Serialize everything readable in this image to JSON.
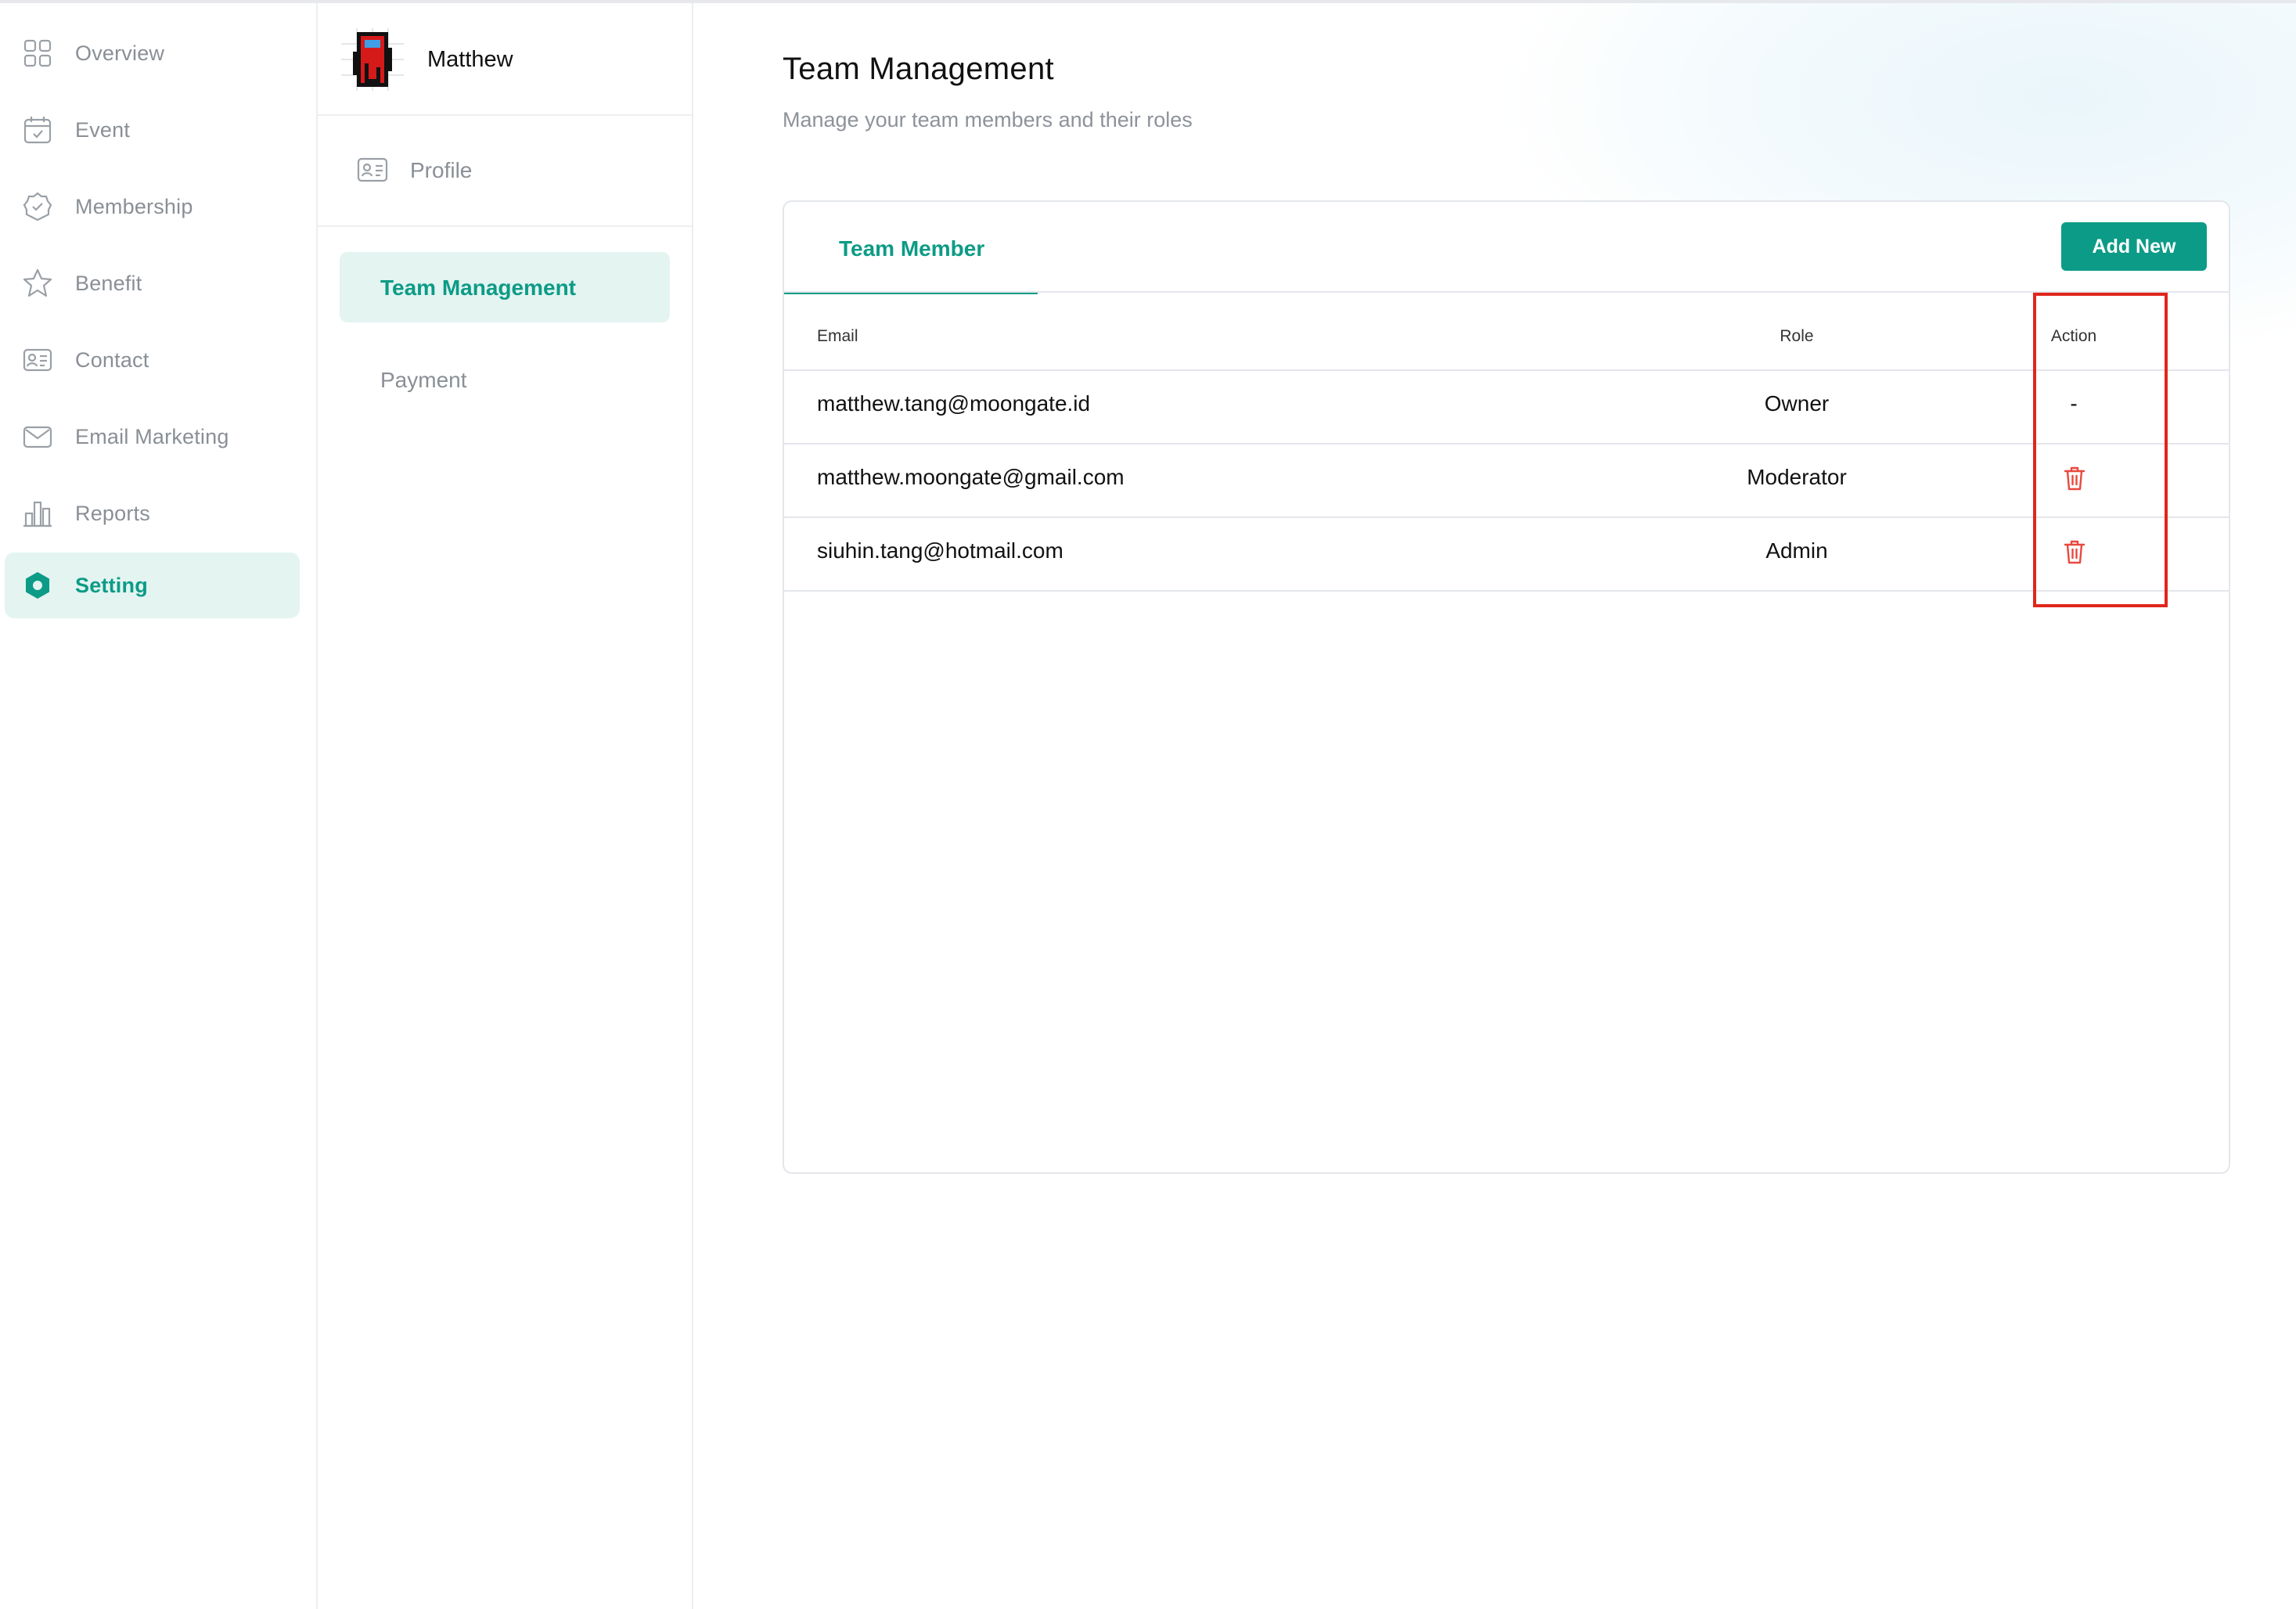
{
  "nav": {
    "items": [
      {
        "label": "Overview",
        "icon": "grid-icon"
      },
      {
        "label": "Event",
        "icon": "calendar-check-icon"
      },
      {
        "label": "Membership",
        "icon": "badge-check-icon"
      },
      {
        "label": "Benefit",
        "icon": "star-icon"
      },
      {
        "label": "Contact",
        "icon": "id-card-icon"
      },
      {
        "label": "Email Marketing",
        "icon": "mail-icon"
      },
      {
        "label": "Reports",
        "icon": "bar-chart-icon"
      },
      {
        "label": "Setting",
        "icon": "hexagon-icon",
        "active": true
      }
    ]
  },
  "settings": {
    "username": "Matthew",
    "profile_label": "Profile",
    "menu": [
      {
        "label": "Team Management",
        "active": true
      },
      {
        "label": "Payment"
      }
    ]
  },
  "main": {
    "title": "Team Management",
    "subtitle": "Manage your team members and their roles",
    "tab_label": "Team Member",
    "add_button": "Add New",
    "table": {
      "headers": [
        "Email",
        "Role",
        "Action"
      ],
      "rows": [
        {
          "email": "matthew.tang@moongate.id",
          "role": "Owner",
          "action": "-"
        },
        {
          "email": "matthew.moongate@gmail.com",
          "role": "Moderator",
          "action": "delete-icon"
        },
        {
          "email": "siuhin.tang@hotmail.com",
          "role": "Admin",
          "action": "delete-icon"
        }
      ]
    }
  },
  "colors": {
    "accent": "#0c9b86",
    "accent_light": "#e3f4f1",
    "delete": "#e8493e",
    "highlight": "#e0261c"
  }
}
